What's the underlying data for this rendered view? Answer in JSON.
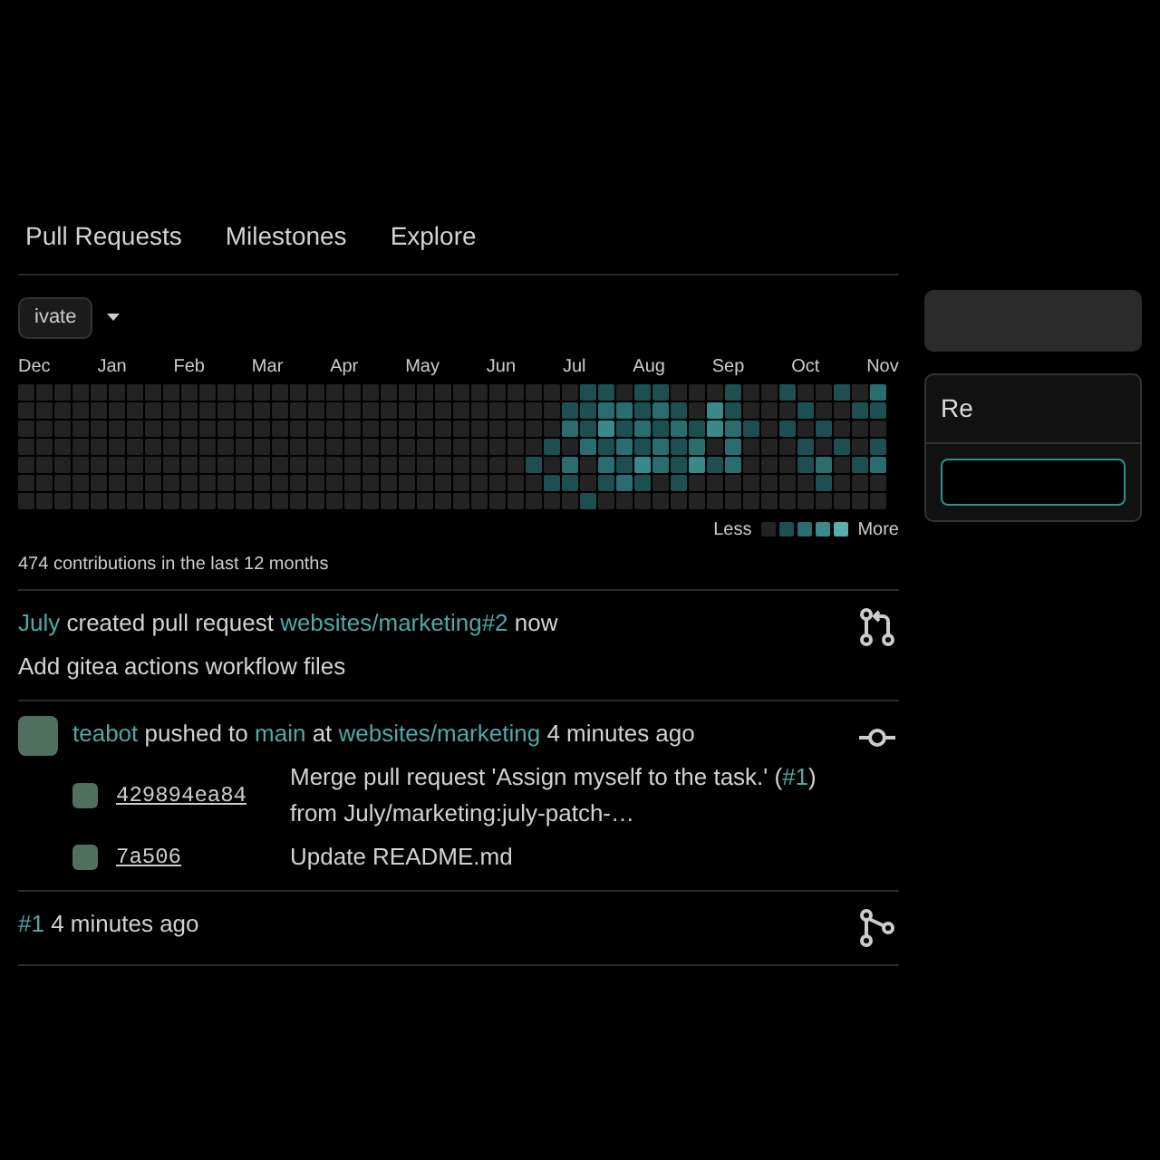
{
  "nav": {
    "items": [
      {
        "label": "Pull Requests"
      },
      {
        "label": "Milestones"
      },
      {
        "label": "Explore"
      }
    ]
  },
  "filter": {
    "label": "ivate"
  },
  "heatmap": {
    "months": [
      "Dec",
      "Jan",
      "Feb",
      "Mar",
      "Apr",
      "May",
      "Jun",
      "Jul",
      "Aug",
      "Sep",
      "Oct",
      "Nov"
    ],
    "legend": {
      "less": "Less",
      "more": "More"
    },
    "summary": "474 contributions in the last 12 months"
  },
  "feed": [
    {
      "kind": "pull_request",
      "header": [
        {
          "text": "July",
          "link": true
        },
        {
          "text": "created pull request",
          "link": false
        },
        {
          "text": "websites/marketing#2",
          "link": true
        },
        {
          "text": "now",
          "link": false
        }
      ],
      "title": "Add gitea actions workflow files"
    },
    {
      "kind": "push",
      "header": [
        {
          "text": "teabot",
          "link": true
        },
        {
          "text": "pushed to",
          "link": false
        },
        {
          "text": "main",
          "link": true
        },
        {
          "text": "at",
          "link": false
        },
        {
          "text": "websites/marketing",
          "link": true
        },
        {
          "text": "4 minutes ago",
          "link": false
        }
      ],
      "commits": [
        {
          "sha": "429894ea84",
          "message": [
            {
              "text": "Merge pull request 'Assign myself to the task.' (",
              "link": false
            },
            {
              "text": "#1",
              "link": true
            },
            {
              "text": ") from July/marketing:july-patch-…",
              "link": false
            }
          ]
        },
        {
          "sha": "7a506",
          "message": [
            {
              "text": "Update README.md",
              "link": false
            }
          ]
        }
      ]
    },
    {
      "kind": "merge",
      "header": [
        {
          "text": "#1",
          "link": true
        },
        {
          "text": "4 minutes ago",
          "link": false
        }
      ]
    }
  ],
  "sidebar": {
    "panel_title": "Re"
  }
}
